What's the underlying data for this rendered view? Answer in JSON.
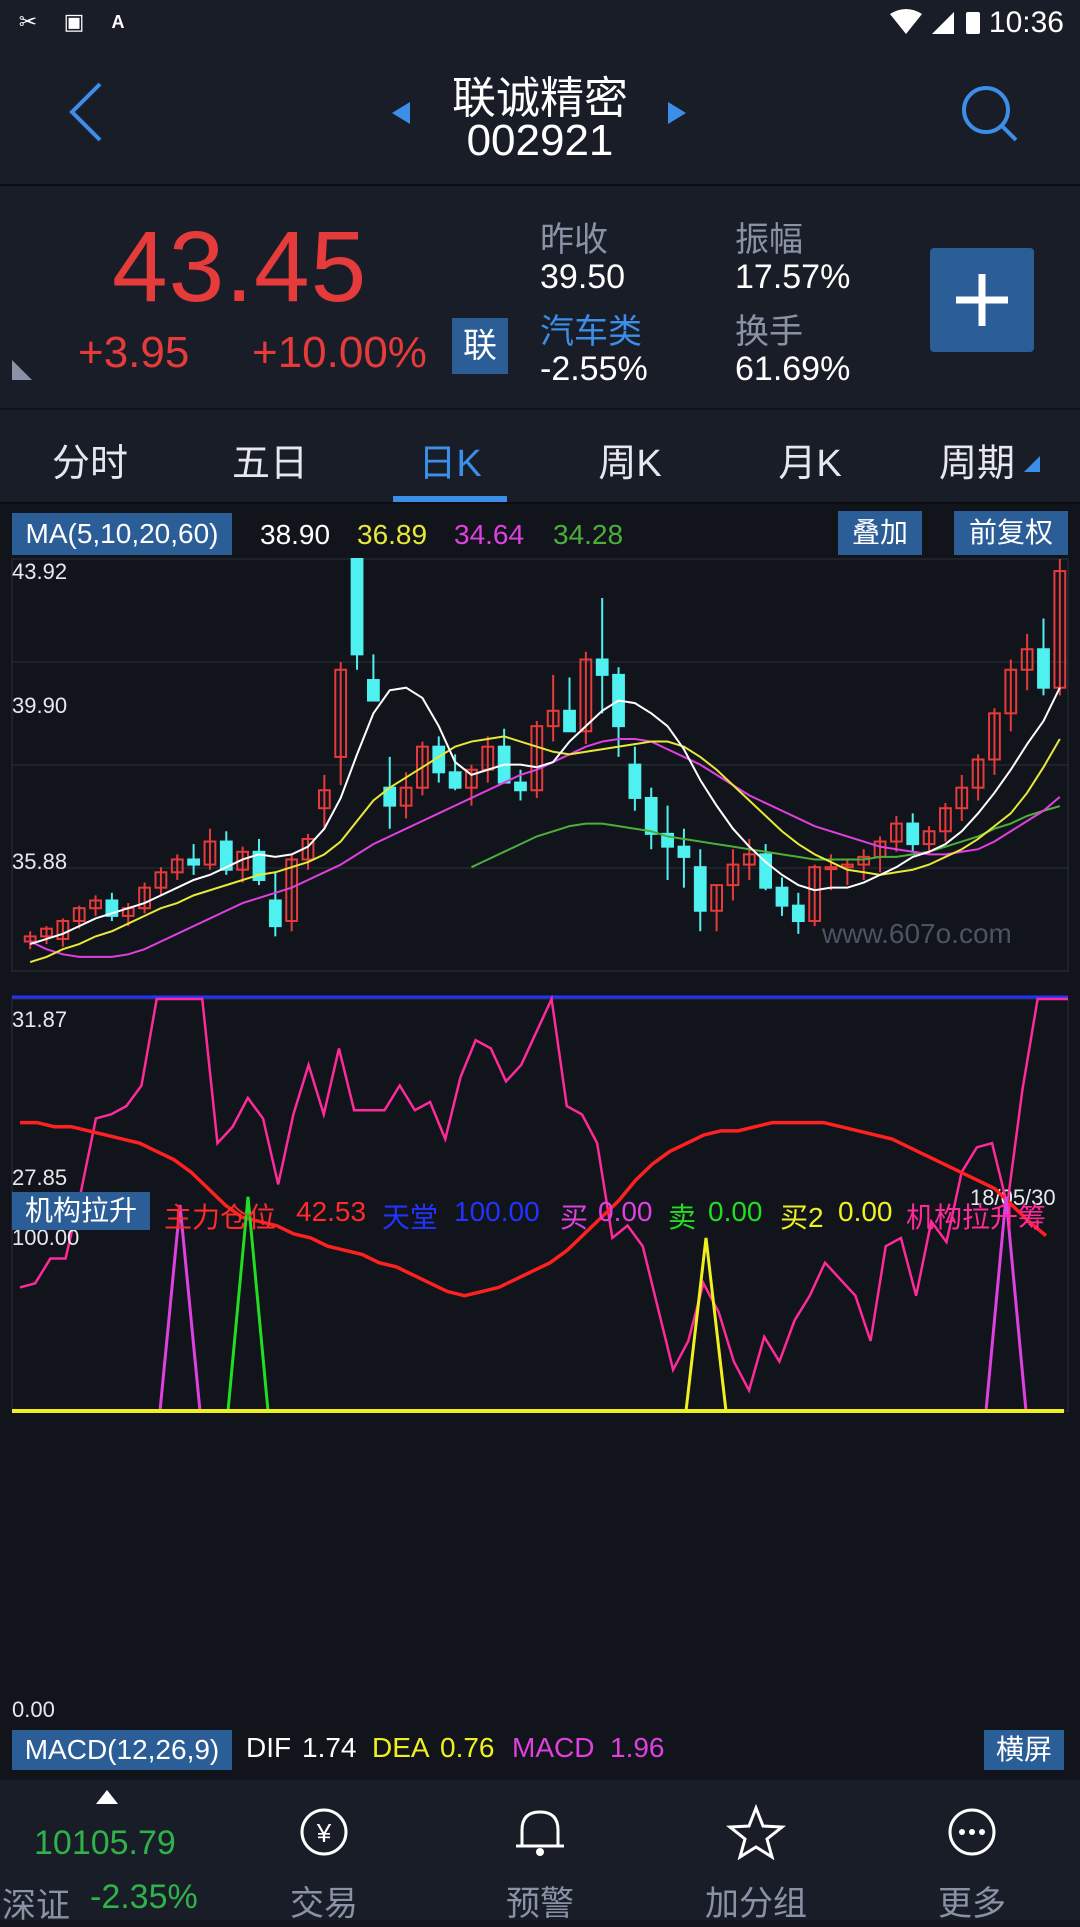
{
  "status_bar": {
    "time": "10:36"
  },
  "header": {
    "stock_name": "联诚精密",
    "stock_code": "002921"
  },
  "quote": {
    "price": "43.45",
    "change": "+3.95",
    "change_pct": "+10.00%",
    "badge": "联",
    "prev_close_label": "昨收",
    "prev_close": "39.50",
    "sector_label": "汽车类",
    "sector_change": "-2.55%",
    "amplitude_label": "振幅",
    "amplitude": "17.57%",
    "turnover_label": "换手",
    "turnover": "61.69%"
  },
  "tabs": [
    {
      "label": "分时"
    },
    {
      "label": "五日"
    },
    {
      "label": "日K"
    },
    {
      "label": "周K"
    },
    {
      "label": "月K"
    },
    {
      "label": "周期"
    }
  ],
  "active_tab": "日K",
  "ma": {
    "label": "MA(5,10,20,60)",
    "ma5": "38.90",
    "ma10": "36.89",
    "ma20": "34.64",
    "ma60": "34.28",
    "overlay_label": "叠加",
    "adjust_label": "前复权",
    "colors": {
      "ma5": "#ffffff",
      "ma10": "#e8e83a",
      "ma20": "#e040e0",
      "ma60": "#4caf3a"
    }
  },
  "price_axis": [
    "43.92",
    "39.90",
    "35.88",
    "31.87",
    "27.85"
  ],
  "watermark": "www.607o.com",
  "chart_date": "18/05/30",
  "indicator": {
    "name": "机构拉升",
    "items": [
      {
        "label": "主力仓位",
        "value": "42.53",
        "color": "#ff2a2a"
      },
      {
        "label": "天堂",
        "value": "100.00",
        "color": "#2233ff"
      },
      {
        "label": "买",
        "value": "0.00",
        "color": "#e040e0"
      },
      {
        "label": "卖",
        "value": "0.00",
        "color": "#22dd22"
      },
      {
        "label": "买2",
        "value": "0.00",
        "color": "#f0f020"
      }
    ],
    "tail_label": "机构拉升筹",
    "axis_top": "100.00",
    "axis_bottom": "0.00"
  },
  "macd": {
    "label": "MACD(12,26,9)",
    "dif_label": "DIF",
    "dif": "1.74",
    "dea_label": "DEA",
    "dea": "0.76",
    "macd_label": "MACD",
    "macd": "1.96",
    "landscape_label": "横屏"
  },
  "index_ticker": {
    "value": "10105.79",
    "name": "深证",
    "change": "-2.35%"
  },
  "bottom_nav": [
    {
      "label": "交易",
      "icon": "yen-exchange-icon"
    },
    {
      "label": "预警",
      "icon": "bell-icon"
    },
    {
      "label": "加分组",
      "icon": "star-icon"
    },
    {
      "label": "更多",
      "icon": "more-icon"
    }
  ],
  "chart_data": {
    "type": "candlestick",
    "ylim": [
      27.85,
      43.92
    ],
    "ohlc": [
      [
        29.0,
        29.4,
        28.7,
        29.2
      ],
      [
        29.2,
        29.6,
        28.9,
        29.5
      ],
      [
        29.1,
        29.9,
        28.8,
        29.8
      ],
      [
        29.8,
        30.4,
        29.5,
        30.3
      ],
      [
        30.3,
        30.8,
        30.0,
        30.6
      ],
      [
        30.6,
        30.9,
        29.8,
        30.0
      ],
      [
        30.0,
        30.5,
        29.6,
        30.3
      ],
      [
        30.3,
        31.3,
        30.1,
        31.1
      ],
      [
        31.1,
        31.9,
        30.8,
        31.7
      ],
      [
        31.7,
        32.4,
        31.4,
        32.2
      ],
      [
        32.2,
        32.8,
        31.6,
        32.0
      ],
      [
        32.0,
        33.4,
        31.8,
        32.9
      ],
      [
        32.9,
        33.3,
        31.6,
        31.8
      ],
      [
        31.8,
        32.7,
        31.3,
        32.5
      ],
      [
        32.5,
        33.0,
        31.2,
        31.4
      ],
      [
        30.6,
        31.7,
        29.2,
        29.6
      ],
      [
        29.8,
        32.4,
        29.4,
        32.2
      ],
      [
        32.2,
        33.2,
        31.8,
        33.0
      ],
      [
        34.2,
        35.5,
        33.4,
        34.9
      ],
      [
        36.2,
        39.9,
        35.1,
        39.6
      ],
      [
        43.92,
        43.92,
        39.6,
        40.2
      ],
      [
        39.2,
        40.2,
        38.6,
        38.4
      ],
      [
        35.0,
        36.2,
        33.4,
        34.3
      ],
      [
        34.3,
        35.6,
        33.8,
        35.0
      ],
      [
        35.0,
        36.8,
        34.7,
        36.6
      ],
      [
        36.6,
        37.0,
        35.2,
        35.6
      ],
      [
        35.6,
        36.3,
        34.9,
        35.0
      ],
      [
        35.0,
        35.9,
        34.3,
        35.7
      ],
      [
        35.7,
        37.0,
        35.2,
        36.6
      ],
      [
        36.6,
        37.3,
        35.3,
        35.2
      ],
      [
        35.2,
        35.7,
        34.5,
        34.9
      ],
      [
        34.9,
        37.6,
        34.6,
        37.4
      ],
      [
        37.4,
        39.4,
        36.8,
        38.0
      ],
      [
        38.0,
        39.3,
        37.3,
        37.2
      ],
      [
        37.2,
        40.3,
        36.7,
        40.0
      ],
      [
        40.0,
        42.4,
        37.9,
        39.4
      ],
      [
        39.4,
        39.7,
        36.2,
        37.4
      ],
      [
        35.9,
        36.6,
        34.1,
        34.6
      ],
      [
        34.6,
        35.0,
        32.6,
        33.2
      ],
      [
        33.2,
        34.3,
        31.4,
        32.7
      ],
      [
        32.7,
        33.4,
        31.1,
        32.3
      ],
      [
        31.9,
        32.6,
        29.4,
        30.2
      ],
      [
        30.2,
        31.2,
        29.4,
        31.2
      ],
      [
        31.2,
        32.6,
        30.6,
        32.0
      ],
      [
        32.0,
        33.0,
        31.4,
        32.4
      ],
      [
        32.4,
        32.8,
        31.0,
        31.1
      ],
      [
        31.1,
        31.5,
        30.0,
        30.4
      ],
      [
        30.4,
        30.9,
        29.3,
        29.8
      ],
      [
        29.8,
        32.0,
        29.6,
        31.9
      ],
      [
        31.9,
        32.4,
        31.0,
        31.9
      ],
      [
        31.9,
        32.2,
        31.2,
        32.0
      ],
      [
        32.0,
        32.6,
        31.4,
        32.3
      ],
      [
        32.3,
        33.1,
        31.7,
        32.9
      ],
      [
        32.9,
        33.9,
        32.5,
        33.6
      ],
      [
        33.6,
        34.0,
        32.5,
        32.8
      ],
      [
        32.8,
        33.5,
        32.4,
        33.3
      ],
      [
        33.3,
        34.4,
        32.9,
        34.2
      ],
      [
        34.2,
        35.5,
        33.7,
        35.0
      ],
      [
        35.0,
        36.3,
        34.5,
        36.1
      ],
      [
        36.1,
        38.1,
        35.5,
        37.9
      ],
      [
        37.9,
        40.0,
        37.2,
        39.6
      ],
      [
        39.6,
        41.0,
        38.8,
        40.4
      ],
      [
        40.4,
        41.6,
        38.6,
        38.9
      ],
      [
        38.9,
        43.92,
        38.6,
        43.45
      ]
    ],
    "ma5": [
      28.9,
      29.1,
      29.3,
      29.6,
      29.9,
      30.1,
      30.3,
      30.5,
      30.8,
      31.1,
      31.4,
      31.6,
      31.9,
      32.2,
      32.4,
      32.3,
      32.4,
      32.7,
      33.4,
      34.6,
      36.3,
      37.9,
      38.8,
      38.9,
      38.5,
      37.4,
      36.0,
      35.5,
      35.7,
      35.9,
      35.9,
      35.8,
      36.0,
      36.8,
      37.4,
      38.0,
      38.4,
      38.3,
      37.9,
      37.4,
      36.5,
      35.3,
      34.3,
      33.4,
      32.7,
      32.1,
      31.6,
      31.2,
      31.0,
      31.1,
      31.1,
      31.3,
      31.6,
      31.9,
      32.3,
      32.5,
      32.8,
      33.3,
      34.0,
      34.8,
      35.7,
      36.7,
      37.6,
      38.9
    ],
    "ma10": [
      28.2,
      28.4,
      28.7,
      28.9,
      29.2,
      29.4,
      29.7,
      30.0,
      30.3,
      30.5,
      30.8,
      31.0,
      31.2,
      31.4,
      31.6,
      31.7,
      31.9,
      32.1,
      32.4,
      32.9,
      33.7,
      34.5,
      35.0,
      35.4,
      35.8,
      36.2,
      36.6,
      36.8,
      36.9,
      37.0,
      36.8,
      36.6,
      36.4,
      36.3,
      36.4,
      36.5,
      36.6,
      36.7,
      36.8,
      36.8,
      36.6,
      36.2,
      35.7,
      35.1,
      34.5,
      33.9,
      33.3,
      32.8,
      32.4,
      32.1,
      31.8,
      31.7,
      31.6,
      31.7,
      31.8,
      32.0,
      32.3,
      32.6,
      33.0,
      33.5,
      34.0,
      34.8,
      35.8,
      36.9
    ],
    "ma20": [
      29.0,
      28.7,
      28.5,
      28.4,
      28.4,
      28.4,
      28.5,
      28.7,
      29.0,
      29.3,
      29.6,
      29.9,
      30.2,
      30.5,
      30.7,
      30.9,
      31.1,
      31.4,
      31.7,
      32.0,
      32.4,
      32.8,
      33.1,
      33.4,
      33.7,
      34.0,
      34.3,
      34.6,
      34.9,
      35.2,
      35.5,
      35.7,
      36.0,
      36.3,
      36.6,
      36.8,
      36.9,
      36.9,
      36.8,
      36.5,
      36.2,
      35.9,
      35.5,
      35.1,
      34.7,
      34.4,
      34.1,
      33.8,
      33.5,
      33.3,
      33.1,
      32.9,
      32.7,
      32.6,
      32.5,
      32.4,
      32.4,
      32.5,
      32.6,
      32.9,
      33.3,
      33.7,
      34.1,
      34.64
    ],
    "ma60": [
      null,
      null,
      null,
      null,
      null,
      null,
      null,
      null,
      null,
      null,
      null,
      null,
      null,
      null,
      null,
      null,
      null,
      null,
      null,
      null,
      null,
      null,
      null,
      null,
      null,
      null,
      null,
      31.9,
      32.2,
      32.5,
      32.8,
      33.1,
      33.3,
      33.5,
      33.6,
      33.6,
      33.5,
      33.4,
      33.3,
      33.1,
      33.0,
      32.9,
      32.8,
      32.7,
      32.6,
      32.5,
      32.4,
      32.3,
      32.2,
      32.2,
      32.2,
      32.2,
      32.3,
      32.3,
      32.4,
      32.5,
      32.7,
      32.9,
      33.1,
      33.4,
      33.6,
      33.9,
      34.1,
      34.28
    ],
    "indicator": {
      "ylim": [
        0,
        100
      ],
      "main_position": [
        70,
        70,
        69,
        69,
        68,
        67,
        66,
        65,
        63,
        61,
        58,
        54,
        50,
        47,
        46,
        45,
        43,
        42,
        40,
        39,
        38,
        36,
        35,
        33,
        31,
        29,
        28,
        29,
        30,
        32,
        34,
        36,
        39,
        43,
        47,
        51,
        56,
        60,
        63,
        65,
        67,
        68,
        68,
        69,
        70,
        70,
        70,
        70,
        69,
        68,
        67,
        66,
        64,
        62,
        60,
        58,
        56,
        54,
        50,
        46,
        42.53
      ],
      "tiantang": [
        30,
        31,
        37,
        37,
        53,
        71,
        72,
        74,
        79,
        100,
        100,
        100,
        100,
        65,
        69,
        76,
        71,
        55,
        72,
        84,
        72,
        88,
        73,
        73,
        73,
        79,
        73,
        75,
        66,
        81,
        90,
        88,
        80,
        84,
        92,
        100,
        74,
        72,
        65,
        42,
        45,
        40,
        25,
        10,
        17,
        31,
        24,
        12,
        5,
        18,
        12,
        22,
        28,
        36,
        32,
        28,
        17,
        40,
        42,
        28,
        46,
        41,
        58,
        64,
        65,
        50,
        78,
        100,
        100,
        100
      ]
    }
  }
}
